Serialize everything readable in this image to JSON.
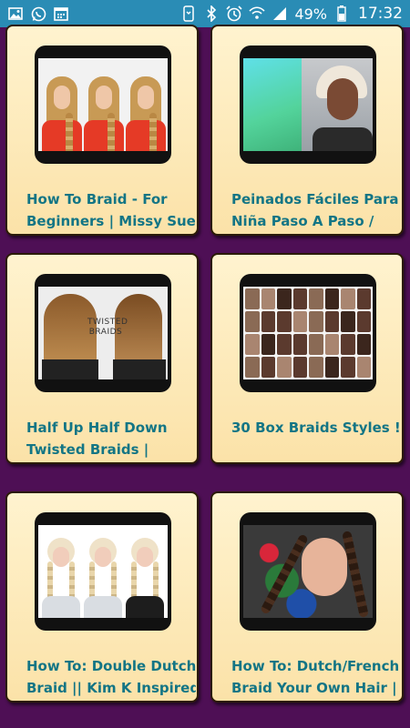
{
  "status_bar": {
    "left_icons": [
      "image-icon",
      "whatsapp-icon",
      "calendar-icon"
    ],
    "right_icons": [
      "vibrate-icon",
      "bluetooth-icon",
      "alarm-icon",
      "wifi-icon",
      "signal-icon",
      "battery-icon"
    ],
    "battery": "49%",
    "time": "17:32"
  },
  "videos": [
    {
      "title_line1": "How To Braid - For",
      "title_line2": "Beginners | Missy Sue"
    },
    {
      "title_line1": "Peinados Fáciles Para",
      "title_line2": "Niña Paso A Paso /"
    },
    {
      "title_line1": "Half Up Half Down",
      "title_line2": "Twisted Braids |",
      "thumb_text_line1": "TWISTED",
      "thumb_text_line2": "BRAIDS"
    },
    {
      "title_line1": "30 Box Braids Styles !",
      "title_line2": ""
    },
    {
      "title_line1": "How To: Double Dutch",
      "title_line2": "Braid || Kim K Inspired"
    },
    {
      "title_line1": "How To: Dutch/French",
      "title_line2": "Braid Your Own Hair |"
    }
  ],
  "colors": {
    "background": "#4e0f55",
    "status_bar": "#2a8cb5",
    "card": "#fdebbd",
    "title": "#137585"
  }
}
